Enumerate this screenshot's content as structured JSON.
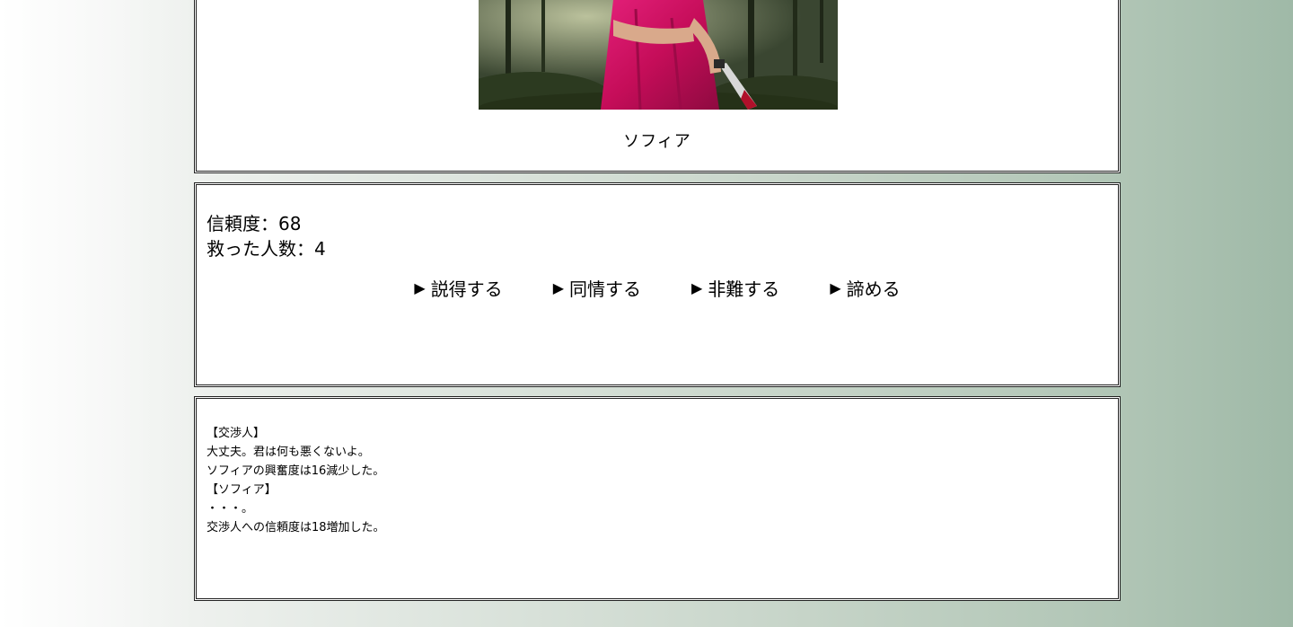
{
  "character": {
    "name": "ソフィア"
  },
  "status": {
    "trust_line": "信頼度：68",
    "saved_line": "救った人数：4",
    "trust_value": 68,
    "saved_value": 4
  },
  "actions": [
    {
      "label": "説得する",
      "icon": "play-triangle-icon"
    },
    {
      "label": "同情する",
      "icon": "play-triangle-icon"
    },
    {
      "label": "非難する",
      "icon": "play-triangle-icon"
    },
    {
      "label": "諦める",
      "icon": "play-triangle-icon"
    }
  ],
  "log": [
    "【交渉人】",
    "大丈夫。君は何も悪くないよ。",
    "ソフィアの興奮度は16減少した。",
    "【ソフィア】",
    "・・・。",
    "交渉人への信頼度は18増加した。"
  ],
  "colors": {
    "dress": "#d0145f",
    "forest": "#3d4a33",
    "panel_border": "#222222"
  }
}
